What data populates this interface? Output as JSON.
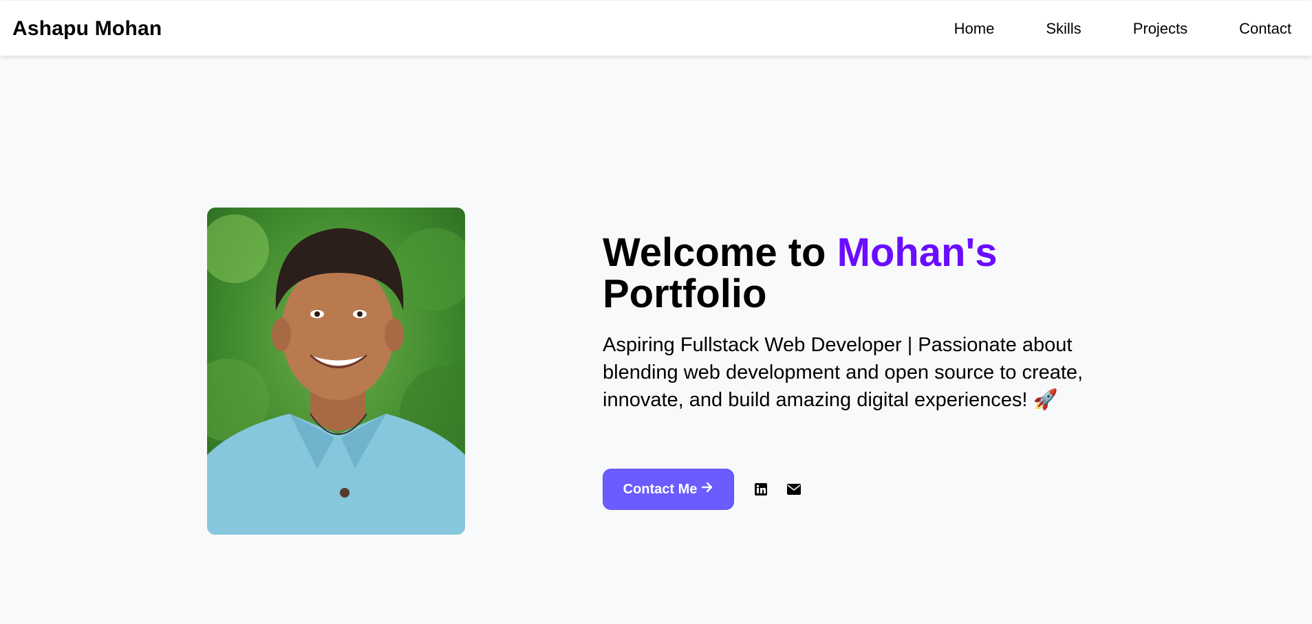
{
  "header": {
    "brand": "Ashapu Mohan",
    "nav": [
      "Home",
      "Skills",
      "Projects",
      "Contact"
    ]
  },
  "hero": {
    "title_prefix": "Welcome to ",
    "title_accent": "Mohan's",
    "title_suffix": "Portfolio",
    "subtitle": "Aspiring Fullstack Web Developer | Passionate about blending web development and open source to create, innovate, and build amazing digital experiences! 🚀",
    "cta_label": "Contact Me",
    "cta_icon": "arrow-right-icon",
    "socials": [
      "linkedin-icon",
      "envelope-icon"
    ]
  },
  "colors": {
    "accent": "#6a0dff",
    "button": "#6a5cff",
    "background": "#f8f9fa"
  }
}
